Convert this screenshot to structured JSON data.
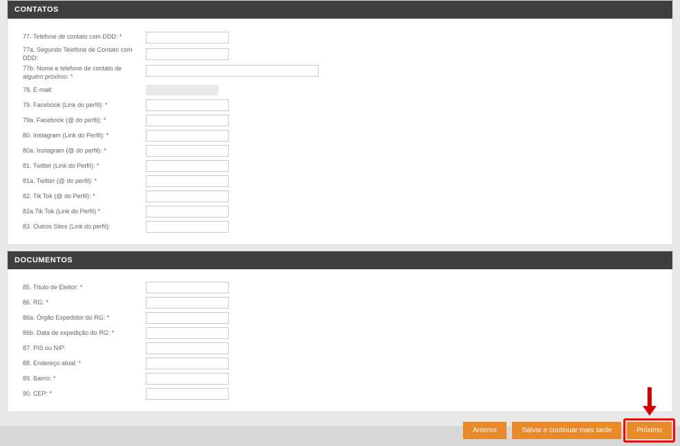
{
  "sections": {
    "contatos": {
      "title": "CONTATOS",
      "fields": {
        "f77": "77. Telefone de contato com DDD: *",
        "f77a": "77a. Segundo Telefone de Contato com DDD:",
        "f77b": "77b. Nome e telefone de contato de alguém próximo: *",
        "f78": "78. E-mail:",
        "f79": "79. Facebook (Link do perfil): *",
        "f79a": "79a. Facebook (@ do perfil): *",
        "f80": "80. Instagram (Link do Perfil): *",
        "f80a": "80a. Instagram (@ do perfil): *",
        "f81": "81. Twitter (Link do Perfil): *",
        "f81a": "81a. Twitter (@ do perfil): *",
        "f82": "82. Tik Tok (@ do Perfil): *",
        "f82a": "82a.Tik Tok (Link do Perfil) *",
        "f83": "83. Outros Sites (Link do perfil):"
      }
    },
    "documentos": {
      "title": "DOCUMENTOS",
      "fields": {
        "f85": "85. Título de Eleitor: *",
        "f86": "86. RG: *",
        "f86a": "86a. Órgão Expedidor do RG: *",
        "f86b": "86b. Data de expedição do RG: *",
        "f87": "87. PIS ou NIP:",
        "f88": "88. Endereço atual: *",
        "f89": "89. Bairro: *",
        "f90": "90. CEP: *"
      }
    }
  },
  "buttons": {
    "prev": "Anterior",
    "save": "Salvar e continuar mais tarde",
    "next": "Próximo"
  }
}
